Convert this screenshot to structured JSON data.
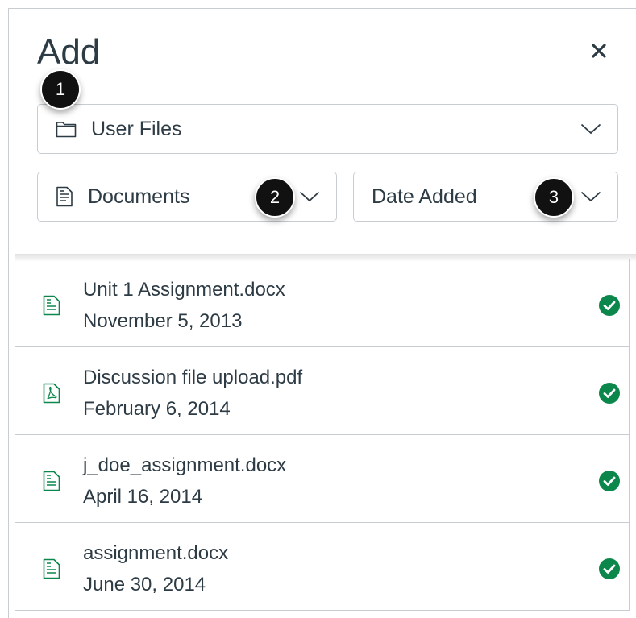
{
  "header": {
    "title": "Add",
    "close_icon": "close-icon"
  },
  "filters": {
    "source": {
      "label": "User Files",
      "icon": "folder-icon"
    },
    "type": {
      "label": "Documents",
      "icon": "document-icon"
    },
    "sort": {
      "label": "Date Added"
    }
  },
  "callouts": [
    "1",
    "2",
    "3"
  ],
  "files": [
    {
      "name": "Unit 1 Assignment.docx",
      "date": "November 5, 2013",
      "icon": "docx-file-icon",
      "status": "check-circle-icon"
    },
    {
      "name": "Discussion file upload.pdf",
      "date": "February 6, 2014",
      "icon": "pdf-file-icon",
      "status": "check-circle-icon"
    },
    {
      "name": "j_doe_assignment.docx",
      "date": "April 16, 2014",
      "icon": "docx-file-icon",
      "status": "check-circle-icon"
    },
    {
      "name": "assignment.docx",
      "date": "June 30, 2014",
      "icon": "docx-file-icon",
      "status": "check-circle-icon"
    }
  ],
  "colors": {
    "text": "#2d3b45",
    "border": "#c7cdd1",
    "success": "#0b874b",
    "file_icon": "#0b874b",
    "badge": "#111111"
  }
}
